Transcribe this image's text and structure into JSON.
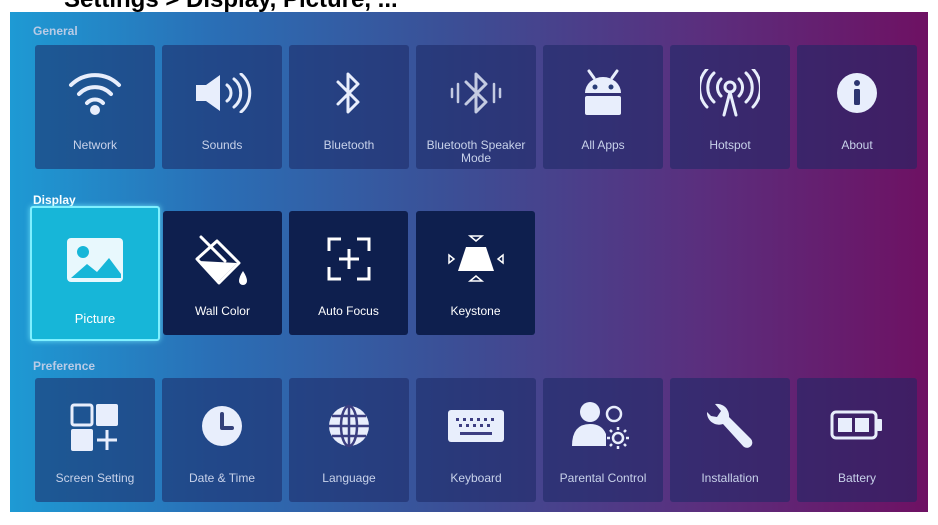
{
  "header_text": "Settings > Display, Picture, ...",
  "sections": {
    "general": "General",
    "display": "Display",
    "preference": "Preference"
  },
  "general_items": [
    {
      "label": "Network",
      "icon": "wifi-icon"
    },
    {
      "label": "Sounds",
      "icon": "speaker-icon"
    },
    {
      "label": "Bluetooth",
      "icon": "bluetooth-icon"
    },
    {
      "label": "Bluetooth Speaker Mode",
      "line1": "Bluetooth Speaker",
      "line2": "Mode",
      "icon": "bluetooth-speaker-icon"
    },
    {
      "label": "All Apps",
      "icon": "android-icon"
    },
    {
      "label": "Hotspot",
      "icon": "hotspot-icon"
    },
    {
      "label": "About",
      "icon": "info-icon"
    }
  ],
  "display_items": [
    {
      "label": "Picture",
      "icon": "picture-icon",
      "selected": true
    },
    {
      "label": "Wall Color",
      "icon": "paint-bucket-icon"
    },
    {
      "label": "Auto Focus",
      "icon": "auto-focus-icon"
    },
    {
      "label": "Keystone",
      "icon": "keystone-icon"
    }
  ],
  "preference_items": [
    {
      "label": "Screen Setting",
      "icon": "screen-setting-icon"
    },
    {
      "label": "Date & Time",
      "icon": "clock-icon"
    },
    {
      "label": "Language",
      "icon": "globe-icon"
    },
    {
      "label": "Keyboard",
      "icon": "keyboard-icon"
    },
    {
      "label": "Parental Control",
      "icon": "parental-control-icon"
    },
    {
      "label": "Installation",
      "icon": "wrench-icon"
    },
    {
      "label": "Battery",
      "icon": "battery-icon"
    }
  ],
  "colors": {
    "selected_tile": "#17b6d8",
    "dark_tile": "#0e1f4e",
    "gradient_start": "#1e9ad4",
    "gradient_end": "#6e1163"
  }
}
